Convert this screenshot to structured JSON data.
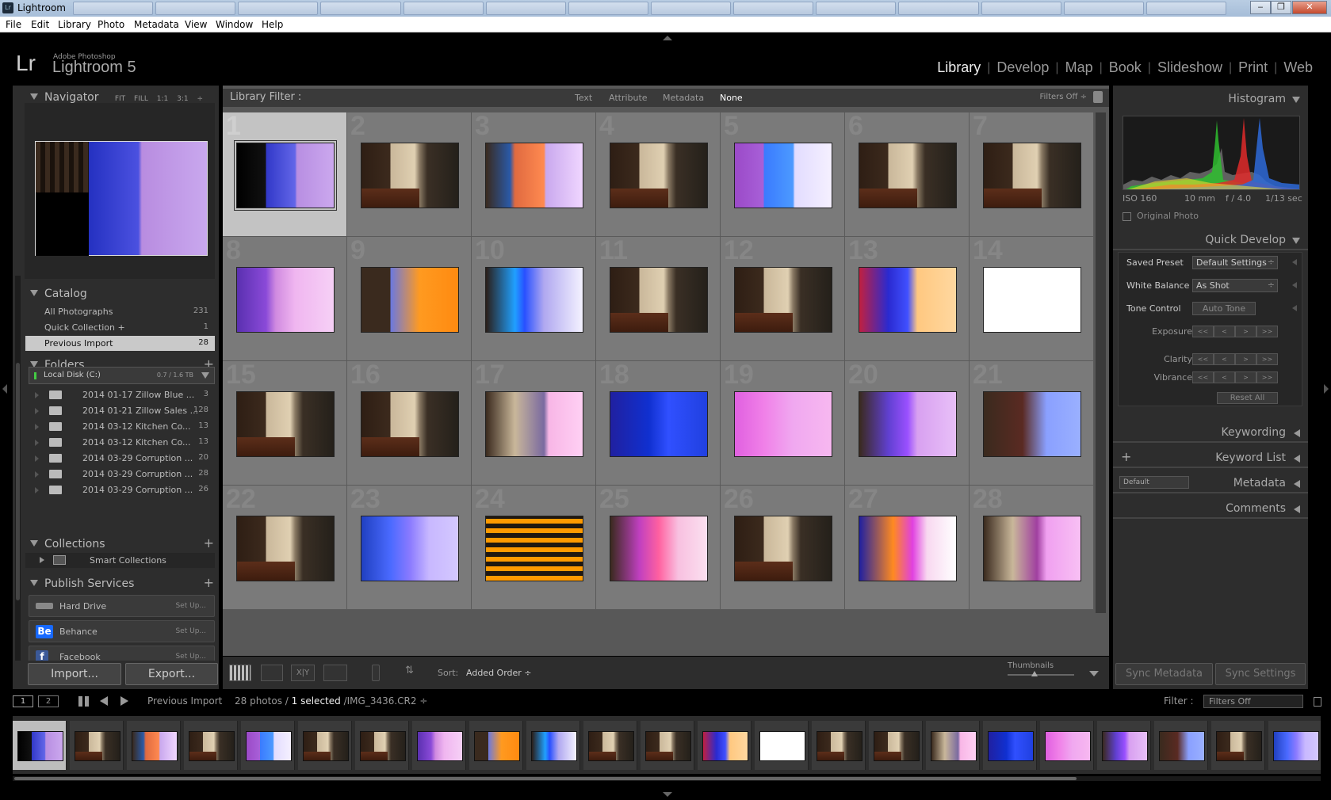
{
  "window": {
    "title": "Lightroom",
    "icon": "Lr"
  },
  "menu": [
    "File",
    "Edit",
    "Library",
    "Photo",
    "Metadata",
    "View",
    "Window",
    "Help"
  ],
  "brand": {
    "logo": "Lr",
    "company": "Adobe Photoshop",
    "product": "Lightroom 5"
  },
  "modules": [
    "Library",
    "Develop",
    "Map",
    "Book",
    "Slideshow",
    "Print",
    "Web"
  ],
  "active_module": "Library",
  "navigator": {
    "title": "Navigator",
    "options": "FIT  FILL  1:1  3:1 ÷"
  },
  "catalog": {
    "title": "Catalog",
    "items": [
      {
        "label": "All Photographs",
        "count": "231"
      },
      {
        "label": "Quick Collection  +",
        "count": "1"
      },
      {
        "label": "Previous Import",
        "count": "28"
      }
    ]
  },
  "folders": {
    "title": "Folders",
    "disk": {
      "label": "Local Disk (C:)",
      "space": "0.7 / 1.6 TB"
    },
    "items": [
      {
        "label": "2014 01-17 Zillow Blue ...",
        "count": "3"
      },
      {
        "label": "2014 01-21 Zillow Sales ...",
        "count": "128"
      },
      {
        "label": "2014 03-12 Kitchen Co...",
        "count": "13"
      },
      {
        "label": "2014 03-12 Kitchen Co...",
        "count": "13"
      },
      {
        "label": "2014 03-29 Corruption ...",
        "count": "20"
      },
      {
        "label": "2014 03-29 Corruption ...",
        "count": "28"
      },
      {
        "label": "2014 03-29 Corruption ...",
        "count": "26"
      }
    ]
  },
  "collections": {
    "title": "Collections",
    "smart": "Smart Collections"
  },
  "publish": {
    "title": "Publish Services",
    "items": [
      {
        "label": "Hard Drive",
        "action": "Set Up..."
      },
      {
        "label": "Behance",
        "action": "Set Up..."
      },
      {
        "label": "Facebook",
        "action": "Set Up..."
      }
    ],
    "behance_icon": "Be",
    "facebook_icon": "f"
  },
  "buttons": {
    "import": "Import...",
    "export": "Export..."
  },
  "filter": {
    "label": "Library Filter :",
    "options": [
      "Text",
      "Attribute",
      "Metadata",
      "None"
    ],
    "active": "None",
    "status": "Filters Off ÷"
  },
  "grid": {
    "thumbs": [
      "a",
      "room",
      "b",
      "room",
      "c",
      "room",
      "room",
      "d",
      "e",
      "f",
      "room",
      "room",
      "g",
      "h",
      "room",
      "room",
      "i",
      "j",
      "k",
      "l",
      "m",
      "room",
      "n",
      "o",
      "p",
      "room",
      "q",
      "r"
    ]
  },
  "toolbar": {
    "sort_label": "Sort:",
    "sort_value": "Added Order ÷",
    "thumbnails_label": "Thumbnails"
  },
  "histogram": {
    "title": "Histogram",
    "iso": "ISO 160",
    "focal": "10 mm",
    "aperture": "f / 4.0",
    "shutter": "1/13 sec",
    "original_photo": "Original Photo"
  },
  "quick_develop": {
    "title": "Quick Develop",
    "saved_preset_label": "Saved Preset",
    "saved_preset_value": "Default Settings",
    "white_balance_label": "White Balance",
    "white_balance_value": "As Shot",
    "tone_control_label": "Tone Control",
    "auto_tone": "Auto Tone",
    "exposure": "Exposure",
    "clarity": "Clarity",
    "vibrance": "Vibrance",
    "reset": "Reset All",
    "stepper": [
      "<<",
      "<",
      ">",
      ">>"
    ]
  },
  "right_sections": {
    "keywording": "Keywording",
    "keyword_list": "Keyword List",
    "metadata": "Metadata",
    "metadata_preset": "Default",
    "comments": "Comments"
  },
  "sync": {
    "metadata": "Sync Metadata",
    "settings": "Sync Settings"
  },
  "filmbar": {
    "btn1": "1",
    "btn2": "2",
    "source": "Previous Import",
    "count": "28 photos /",
    "selected": "1 selected",
    "file": "/IMG_3436.CR2 ÷",
    "filter_label": "Filter :",
    "filter_value": "Filters Off"
  },
  "filmstrip": [
    "a",
    "room",
    "b",
    "room",
    "c",
    "room",
    "room",
    "d",
    "e",
    "f",
    "room",
    "room",
    "g",
    "h",
    "room",
    "room",
    "i",
    "j",
    "k",
    "l",
    "m",
    "room",
    "n"
  ]
}
